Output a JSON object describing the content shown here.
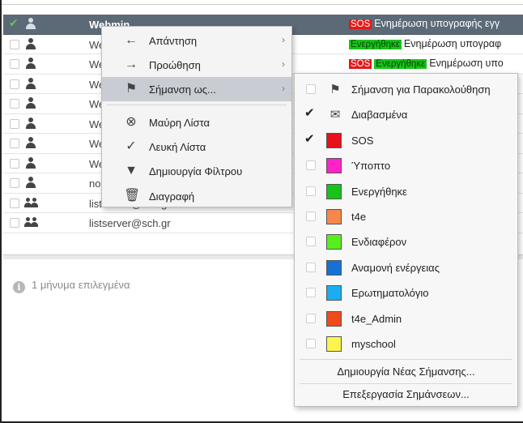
{
  "list": {
    "rows": [
      {
        "sender": "Webmin",
        "kind": "person",
        "selected": true,
        "tags": [
          {
            "label": "SOS",
            "type": "sos"
          }
        ],
        "subject": "Ενημέρωση υπογραφής εγγ"
      },
      {
        "sender": "Web",
        "kind": "person",
        "selected": false,
        "tags": [
          {
            "label": "Ενεργήθηκε",
            "type": "act"
          }
        ],
        "subject": "Ενημέρωση υπογραφ"
      },
      {
        "sender": "Web",
        "kind": "person",
        "selected": false,
        "tags": [
          {
            "label": "SOS",
            "type": "sos"
          },
          {
            "label": "Ενεργήθηκε",
            "type": "act"
          }
        ],
        "subject": "Ενημέρωση υπο"
      },
      {
        "sender": "Web",
        "kind": "person",
        "selected": false,
        "tags": [],
        "subject": ""
      },
      {
        "sender": "Web",
        "kind": "person",
        "selected": false,
        "tags": [],
        "subject": ""
      },
      {
        "sender": "Web",
        "kind": "person",
        "selected": false,
        "tags": [],
        "subject": ""
      },
      {
        "sender": "Web",
        "kind": "person",
        "selected": false,
        "tags": [],
        "subject": ""
      },
      {
        "sender": "Web",
        "kind": "person",
        "selected": false,
        "tags": [],
        "subject": ""
      },
      {
        "sender": "no-r",
        "kind": "person",
        "selected": false,
        "tags": [],
        "subject": ""
      },
      {
        "sender": "listserver@sch.gr",
        "kind": "group",
        "selected": false,
        "tags": [],
        "subject": ""
      },
      {
        "sender": "listserver@sch.gr",
        "kind": "group",
        "selected": false,
        "tags": [],
        "subject": ""
      }
    ]
  },
  "status": {
    "icon": "info-icon",
    "text": "1 μήνυμα επιλεγμένα"
  },
  "context_menu": {
    "items": [
      {
        "label": "Απάντηση",
        "icon": "arrow-left-icon",
        "glyph": "←",
        "submenu": true
      },
      {
        "label": "Προώθηση",
        "icon": "arrow-right-icon",
        "glyph": "→",
        "submenu": true
      },
      {
        "label": "Σήμανση ως...",
        "icon": "flag-icon",
        "glyph": "⚑",
        "submenu": true,
        "hover": true
      },
      {
        "label": "Μαύρη Λίστα",
        "icon": "circle-x-icon",
        "glyph": "⊗",
        "submenu": false
      },
      {
        "label": "Λευκή Λίστα",
        "icon": "circle-check-icon",
        "glyph": "✓",
        "submenu": false
      },
      {
        "label": "Δημιουργία Φίλτρου",
        "icon": "funnel-icon",
        "glyph": "▼",
        "submenu": false
      },
      {
        "label": "Διαγραφή",
        "icon": "trash-icon",
        "glyph": "🗑",
        "submenu": false
      }
    ]
  },
  "flag_menu": {
    "items": [
      {
        "label": "Σήμανση για Παρακολούθηση",
        "icon": "flag-icon",
        "glyph": "⚑",
        "checked": false
      },
      {
        "label": "Διαβασμένα",
        "icon": "envelope-open-icon",
        "glyph": "✉",
        "checked": true
      },
      {
        "label": "SOS",
        "color": "#e8101a",
        "checked": true
      },
      {
        "label": "Ύποπτο",
        "color": "#ff22c8",
        "checked": false
      },
      {
        "label": "Ενεργήθηκε",
        "color": "#16c41b",
        "checked": false
      },
      {
        "label": "t4e",
        "color": "#f7874a",
        "checked": false
      },
      {
        "label": "Ενδιαφέρον",
        "color": "#57ef1c",
        "checked": false
      },
      {
        "label": "Αναμονή ενέργειας",
        "color": "#1572d4",
        "checked": false
      },
      {
        "label": "Ερωτηματολόγιο",
        "color": "#1aaef0",
        "checked": false
      },
      {
        "label": "t4e_Admin",
        "color": "#ef4b1a",
        "checked": false
      },
      {
        "label": "myschool",
        "color": "#fbf54e",
        "checked": false
      }
    ],
    "create_label": "Δημιουργία Νέας Σήμανσης...",
    "edit_label": "Επεξεργασία Σημάνσεων..."
  }
}
